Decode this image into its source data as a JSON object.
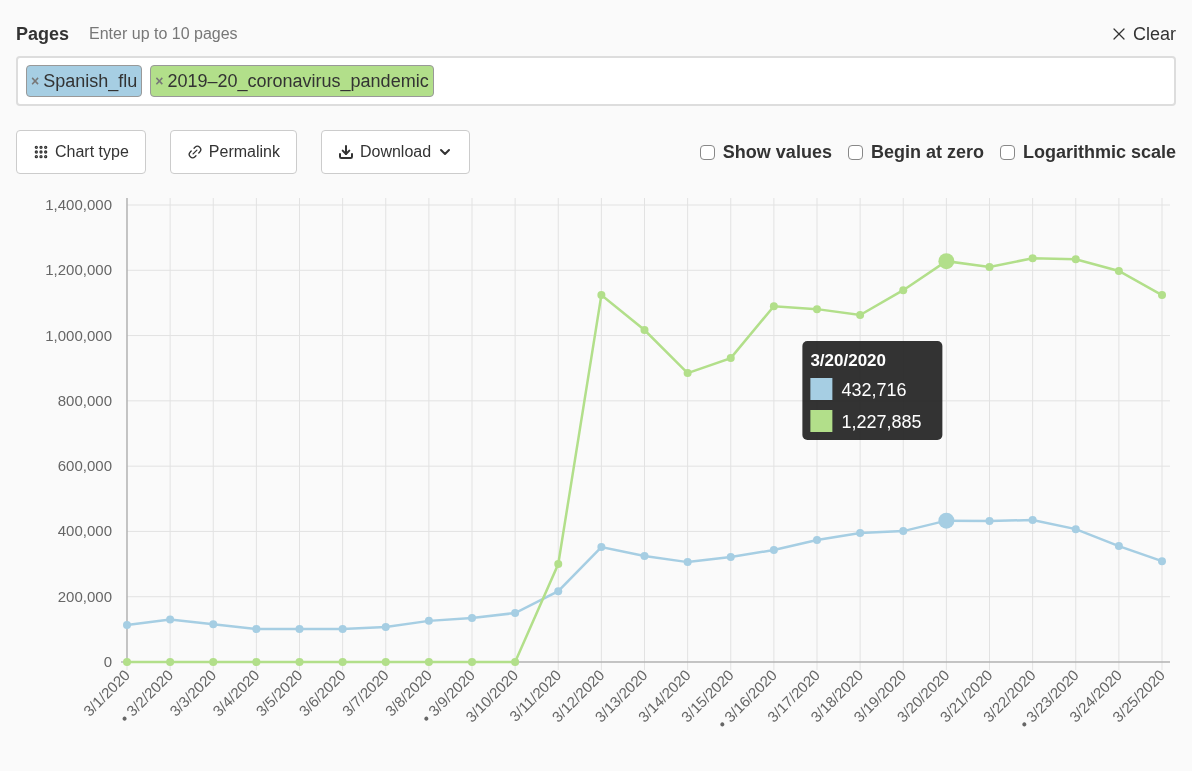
{
  "pages": {
    "label": "Pages",
    "hint": "Enter up to 10 pages",
    "clear": "Clear",
    "chip_remove": "×",
    "items": [
      {
        "title": "Spanish_flu",
        "color": "#a6cee3"
      },
      {
        "title": "2019–20_coronavirus_pandemic",
        "color": "#b2df8a"
      }
    ]
  },
  "toolbar": {
    "buttons": [
      {
        "kind": "chart-type",
        "label": "Chart type"
      },
      {
        "kind": "permalink",
        "label": "Permalink"
      },
      {
        "kind": "download",
        "label": "Download"
      }
    ],
    "options": [
      {
        "label": "Show values",
        "checked": false
      },
      {
        "label": "Begin at zero",
        "checked": false
      },
      {
        "label": "Logarithmic scale",
        "checked": false
      }
    ]
  },
  "chart": {
    "chart_data": {
      "type": "line",
      "categories": [
        "3/1/2020",
        "• 3/2/2020",
        "3/3/2020",
        "3/4/2020",
        "3/5/2020",
        "3/6/2020",
        "3/7/2020",
        "3/8/2020",
        "• 3/9/2020",
        "3/10/2020",
        "3/11/2020",
        "3/12/2020",
        "3/13/2020",
        "3/14/2020",
        "3/15/2020",
        "• 3/16/2020",
        "3/17/2020",
        "3/18/2020",
        "3/19/2020",
        "3/20/2020",
        "3/21/2020",
        "3/22/2020",
        "• 3/23/2020",
        "3/24/2020",
        "3/25/2020"
      ],
      "grid": true,
      "series": [
        {
          "color": "#a6cee3",
          "marker": true,
          "values": [
            113000,
            130000,
            116000,
            101000,
            101000,
            101000,
            107000,
            126000,
            135000,
            150000,
            217000,
            352000,
            325000,
            306000,
            322000,
            343000,
            374000,
            395000,
            401000,
            433000,
            432000,
            435000,
            407000,
            355000,
            309000
          ]
        },
        {
          "color": "#b2df8a",
          "marker": true,
          "values": [
            0,
            0,
            0,
            0,
            0,
            0,
            0,
            0,
            0,
            0,
            300000,
            1124000,
            1017000,
            885000,
            931000,
            1090000,
            1081000,
            1063000,
            1139000,
            1228000,
            1210000,
            1237000,
            1234000,
            1198000,
            1124000
          ]
        }
      ],
      "ylim": [
        0,
        1400000
      ],
      "yticks": [
        {
          "value": 0,
          "label": "0"
        },
        {
          "value": 200000,
          "label": "200,000"
        },
        {
          "value": 400000,
          "label": "400,000"
        },
        {
          "value": 600000,
          "label": "600,000"
        },
        {
          "value": 800000,
          "label": "800,000"
        },
        {
          "value": 1000000,
          "label": "1,000,000"
        },
        {
          "value": 1200000,
          "label": "1,200,000"
        },
        {
          "value": 1400000,
          "label": "1,400,000"
        }
      ]
    },
    "tooltip": {
      "title": "3/20/2020",
      "items": [
        {
          "value": "432,716",
          "color": "#a6cee3"
        },
        {
          "value": "1,227,885",
          "color": "#b2df8a"
        }
      ]
    }
  }
}
